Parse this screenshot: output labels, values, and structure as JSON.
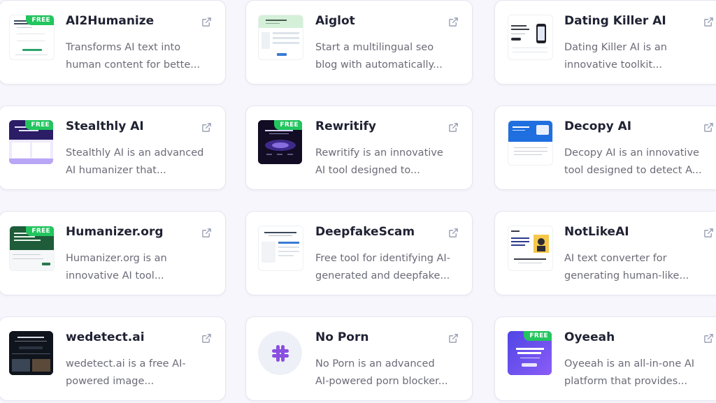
{
  "colors": {
    "background": "#f7f6fc",
    "card": "#ffffff",
    "title": "#1f2233",
    "description": "#6b6b78",
    "free_badge": "#22c55e",
    "icon": "#9aa0b4"
  },
  "tools": [
    {
      "title": "AI2Humanize",
      "desc_line1": "Transforms AI text into",
      "desc_line2": "human content for bette...",
      "badge": "FREE"
    },
    {
      "title": "Aiglot",
      "desc_line1": "Start a multilingual seo",
      "desc_line2": "blog with automatically...",
      "badge": ""
    },
    {
      "title": "Dating Killer AI",
      "desc_line1": "Dating Killer AI is an",
      "desc_line2": "innovative toolkit...",
      "badge": ""
    },
    {
      "title": "Stealthly AI",
      "desc_line1": "Stealthly AI is an advanced",
      "desc_line2": "AI humanizer that...",
      "badge": "FREE"
    },
    {
      "title": "Rewritify",
      "desc_line1": "Rewritify is an innovative",
      "desc_line2": "AI tool designed to...",
      "badge": "FREE"
    },
    {
      "title": "Decopy AI",
      "desc_line1": "Decopy AI is an innovative",
      "desc_line2": "tool designed to detect A...",
      "badge": ""
    },
    {
      "title": "Humanizer.org",
      "desc_line1": "Humanizer.org is an",
      "desc_line2": "innovative AI tool...",
      "badge": "FREE"
    },
    {
      "title": "DeepfakeScam",
      "desc_line1": "Free tool for identifying AI-",
      "desc_line2": "generated and deepfake...",
      "badge": ""
    },
    {
      "title": "NotLikeAI",
      "desc_line1": "AI text converter for",
      "desc_line2": "generating human-like...",
      "badge": ""
    },
    {
      "title": "wedetect.ai",
      "desc_line1": "wedetect.ai is a free AI-",
      "desc_line2": "powered image...",
      "badge": ""
    },
    {
      "title": "No Porn",
      "desc_line1": "No Porn is an advanced",
      "desc_line2": "AI-powered porn blocker...",
      "badge": ""
    },
    {
      "title": "Oyeeah",
      "desc_line1": "Oyeeah is an all-in-one AI",
      "desc_line2": "platform that provides...",
      "badge": "FREE"
    }
  ],
  "icons": {
    "external_link": "external-link-icon",
    "slack": "slack-logo-icon"
  }
}
